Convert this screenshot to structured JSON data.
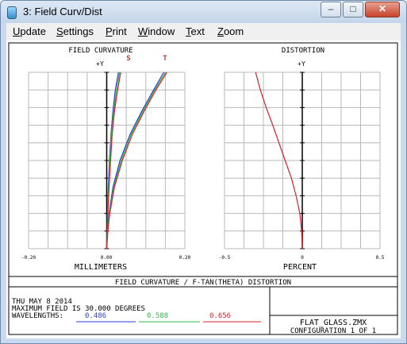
{
  "window": {
    "title": "3: Field Curv/Dist",
    "minimize_glyph": "–",
    "maximize_glyph": "□",
    "close_glyph": "✕"
  },
  "menu": [
    {
      "u": "U",
      "rest": "pdate"
    },
    {
      "u": "S",
      "rest": "ettings"
    },
    {
      "u": "P",
      "rest": "rint"
    },
    {
      "u": "W",
      "rest": "indow"
    },
    {
      "u": "T",
      "rest": "ext"
    },
    {
      "u": "Z",
      "rest": "oom"
    }
  ],
  "colors": {
    "wavelength_1": "#2b3fd6",
    "wavelength_2": "#2fb84a",
    "wavelength_3": "#d6202a",
    "grid": "#b8b8b8"
  },
  "chart_data": [
    {
      "type": "line",
      "title": "FIELD CURVATURE",
      "xlabel": "MILLIMETERS",
      "ylabel": "+Y",
      "xlim": [
        -0.2,
        0.2
      ],
      "ylim": [
        0,
        1
      ],
      "x_tick_labels": [
        "-0.20",
        "0.00",
        "0.20"
      ],
      "curve_labels": [
        "S",
        "T"
      ],
      "grid": true,
      "series": [
        {
          "label": "S",
          "wavelength": "0.486",
          "x": [
            0.0,
            0.001,
            0.002,
            0.004,
            0.007,
            0.011,
            0.016,
            0.022,
            0.03
          ],
          "y": [
            0,
            0.1,
            0.2,
            0.35,
            0.5,
            0.65,
            0.78,
            0.9,
            1.0
          ]
        },
        {
          "label": "S",
          "wavelength": "0.588",
          "x": [
            0.0,
            0.001,
            0.002,
            0.005,
            0.008,
            0.012,
            0.018,
            0.025,
            0.033
          ],
          "y": [
            0,
            0.1,
            0.2,
            0.35,
            0.5,
            0.65,
            0.78,
            0.9,
            1.0
          ]
        },
        {
          "label": "S",
          "wavelength": "0.656",
          "x": [
            0.0,
            0.001,
            0.003,
            0.006,
            0.01,
            0.014,
            0.02,
            0.028,
            0.036
          ],
          "y": [
            0,
            0.1,
            0.2,
            0.35,
            0.5,
            0.65,
            0.78,
            0.9,
            1.0
          ]
        },
        {
          "label": "T",
          "wavelength": "0.486",
          "x": [
            0.0,
            0.002,
            0.006,
            0.016,
            0.034,
            0.06,
            0.09,
            0.12,
            0.146
          ],
          "y": [
            0,
            0.1,
            0.2,
            0.35,
            0.5,
            0.65,
            0.78,
            0.9,
            1.0
          ]
        },
        {
          "label": "T",
          "wavelength": "0.588",
          "x": [
            0.0,
            0.002,
            0.007,
            0.018,
            0.037,
            0.063,
            0.093,
            0.123,
            0.15
          ],
          "y": [
            0,
            0.1,
            0.2,
            0.35,
            0.5,
            0.65,
            0.78,
            0.9,
            1.0
          ]
        },
        {
          "label": "T",
          "wavelength": "0.656",
          "x": [
            0.0,
            0.003,
            0.008,
            0.02,
            0.04,
            0.066,
            0.096,
            0.126,
            0.154
          ],
          "y": [
            0,
            0.1,
            0.2,
            0.35,
            0.5,
            0.65,
            0.78,
            0.9,
            1.0
          ]
        }
      ]
    },
    {
      "type": "line",
      "title": "DISTORTION",
      "xlabel": "PERCENT",
      "ylabel": "+Y",
      "xlim": [
        -0.5,
        0.5
      ],
      "ylim": [
        0,
        1
      ],
      "x_tick_labels": [
        "-0.5",
        "0",
        "0.5"
      ],
      "grid": true,
      "series": [
        {
          "wavelength": "0.656",
          "x": [
            0,
            -0.004,
            -0.016,
            -0.04,
            -0.07,
            -0.11,
            -0.15,
            -0.19,
            -0.232,
            -0.27,
            -0.3
          ],
          "y": [
            0,
            0.1,
            0.2,
            0.3,
            0.4,
            0.5,
            0.6,
            0.7,
            0.8,
            0.9,
            1.0
          ]
        }
      ]
    }
  ],
  "caption": "FIELD CURVATURE / F-TAN(THETA) DISTORTION",
  "info": {
    "date": "THU MAY 8 2014",
    "max_field": "MAXIMUM FIELD IS 30.000 DEGREES",
    "wavelengths_label": "WAVELENGTHS:",
    "wavelengths": [
      "0.486",
      "0.588",
      "0.656"
    ]
  },
  "file": {
    "name": "FLAT_GLASS.ZMX",
    "configuration": "CONFIGURATION 1 OF 1"
  }
}
